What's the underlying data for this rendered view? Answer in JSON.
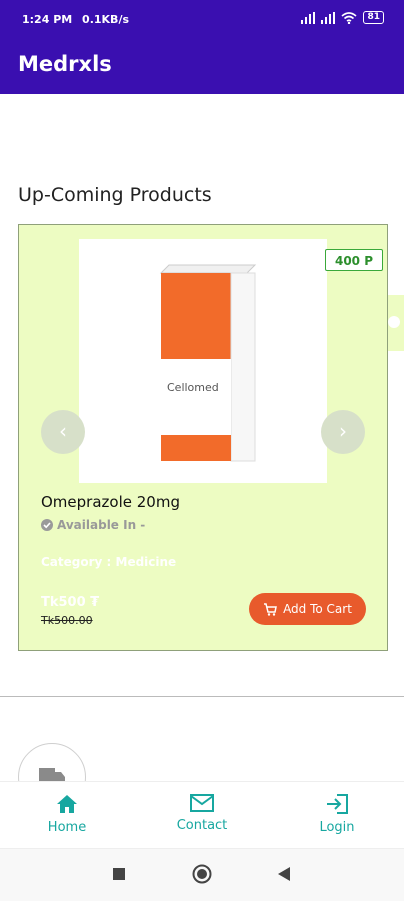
{
  "status": {
    "time": "1:24 PM",
    "speed": "0.1KB/s",
    "battery": "81"
  },
  "app": {
    "title": "Medrxls"
  },
  "section": {
    "title": "Up-Coming Products"
  },
  "product": {
    "name": "Omeprazole 20mg",
    "availability": "Available In -",
    "category": "Category : Medicine",
    "price": "Tk500 ₮",
    "old_price": "Tk500.00",
    "points_badge": "400 P",
    "add_to_cart": "Add To Cart",
    "box_brand": "Cellomed"
  },
  "bottom_nav": [
    {
      "label": "Home",
      "icon": "home-icon"
    },
    {
      "label": "Contact",
      "icon": "mail-icon"
    },
    {
      "label": "Login",
      "icon": "login-icon"
    }
  ],
  "colors": {
    "primary": "#3a0fb0",
    "card_bg": "#edfcc2",
    "accent": "#e85a2c",
    "teal": "#17a7a0"
  }
}
